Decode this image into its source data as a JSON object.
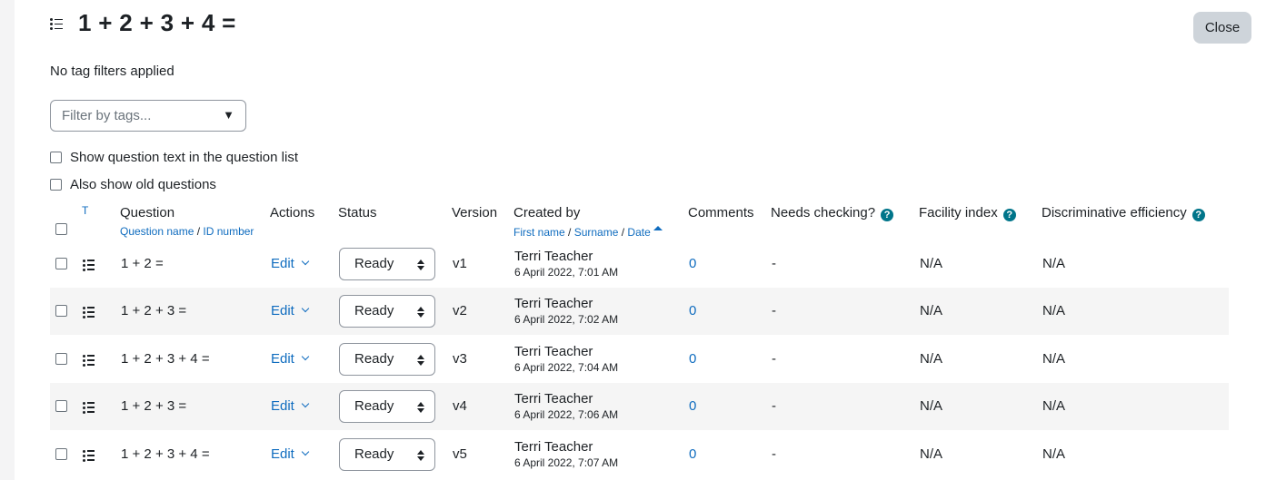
{
  "header": {
    "title": "1 + 2 + 3 + 4 =",
    "close_label": "Close"
  },
  "filters": {
    "no_filters_text": "No tag filters applied",
    "tag_placeholder": "Filter by tags...",
    "tag_caret": "▼",
    "show_text_label": "Show question text in the question list",
    "show_old_label": "Also show old questions"
  },
  "columns": {
    "type": "T",
    "question": "Question",
    "question_sub_name": "Question name",
    "question_sub_sep": " / ",
    "question_sub_id": "ID number",
    "actions": "Actions",
    "status": "Status",
    "version": "Version",
    "created_by": "Created by",
    "created_sub_first": "First name",
    "created_sub_sep1": " / ",
    "created_sub_surname": "Surname",
    "created_sub_sep2": " / ",
    "created_sub_date": "Date",
    "comments": "Comments",
    "needs_checking": "Needs checking?",
    "facility_index": "Facility index",
    "discriminative": "Discriminative efficiency",
    "help_glyph": "?"
  },
  "rows": [
    {
      "question": "1 + 2 =",
      "action": "Edit",
      "status": "Ready",
      "version": "v1",
      "creator": "Terri Teacher",
      "date": "6 April 2022, 7:01 AM",
      "comments": "0",
      "needs_checking": "-",
      "facility": "N/A",
      "discriminative": "N/A"
    },
    {
      "question": "1 + 2 + 3 =",
      "action": "Edit",
      "status": "Ready",
      "version": "v2",
      "creator": "Terri Teacher",
      "date": "6 April 2022, 7:02 AM",
      "comments": "0",
      "needs_checking": "-",
      "facility": "N/A",
      "discriminative": "N/A"
    },
    {
      "question": "1 + 2 + 3 + 4 =",
      "action": "Edit",
      "status": "Ready",
      "version": "v3",
      "creator": "Terri Teacher",
      "date": "6 April 2022, 7:04 AM",
      "comments": "0",
      "needs_checking": "-",
      "facility": "N/A",
      "discriminative": "N/A"
    },
    {
      "question": "1 + 2 + 3 =",
      "action": "Edit",
      "status": "Ready",
      "version": "v4",
      "creator": "Terri Teacher",
      "date": "6 April 2022, 7:06 AM",
      "comments": "0",
      "needs_checking": "-",
      "facility": "N/A",
      "discriminative": "N/A"
    },
    {
      "question": "1 + 2 + 3 + 4 =",
      "action": "Edit",
      "status": "Ready",
      "version": "v5",
      "creator": "Terri Teacher",
      "date": "6 April 2022, 7:07 AM",
      "comments": "0",
      "needs_checking": "-",
      "facility": "N/A",
      "discriminative": "N/A"
    }
  ],
  "icons": {
    "question_type": "list-icon",
    "help": "question-circle-icon",
    "sort": "sort-ascending-icon",
    "edit_menu": "chevron-down-icon"
  },
  "colors": {
    "link": "#0f6cbf",
    "help": "#00758a",
    "close_button": "#ced4da",
    "row_alt": "#f5f5f5"
  }
}
